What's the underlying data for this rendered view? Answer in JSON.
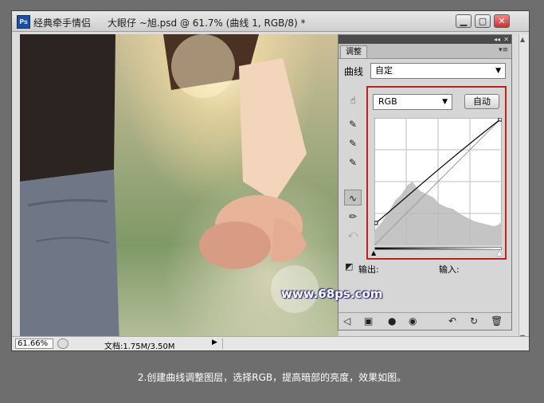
{
  "window": {
    "logo_text": "Ps",
    "app_title": "经典牵手情侣",
    "doc_title": "大眼仔 ~旭.psd @ 61.7% (曲线 1, RGB/8) *",
    "buttons": {
      "minimize": "▁",
      "maximize": "▢",
      "close": "✕"
    }
  },
  "statusbar": {
    "zoom": "61.66%",
    "doc_info": "文档:1.75M/3.50M",
    "arrow": "▶"
  },
  "panel": {
    "tab": "调整",
    "preset_label": "曲线",
    "preset_value": "自定",
    "channel": "RGB",
    "auto_button": "自动",
    "output_label": "输出:",
    "input_label": "输入:",
    "tools": [
      "click-drag-adjust-icon",
      "black-eyedropper-icon",
      "gray-eyedropper-icon",
      "white-eyedropper-icon",
      "curve-point-icon",
      "pencil-icon",
      "smooth-icon"
    ],
    "icons": {
      "tool_adjust": "☝",
      "tool_black": "✎",
      "tool_gray": "✎",
      "tool_white": "✎",
      "tool_curve": "∿",
      "tool_pencil": "✏",
      "tool_smooth": "⤺",
      "clip": "◩",
      "back": "◁",
      "panel_mode": "▣",
      "mask": "●",
      "eye": "◉",
      "reset_view": "↶",
      "reset": "↻",
      "trash": "🗑",
      "collapse": "◂◂",
      "close": "✕",
      "menu": "▾≡"
    },
    "colors": {
      "highlight_border": "#c0201b"
    }
  },
  "watermark": "www.68ps.com",
  "caption": "2.创建曲线调整图层，选择RGB，提高暗部的亮度，效果如图。"
}
